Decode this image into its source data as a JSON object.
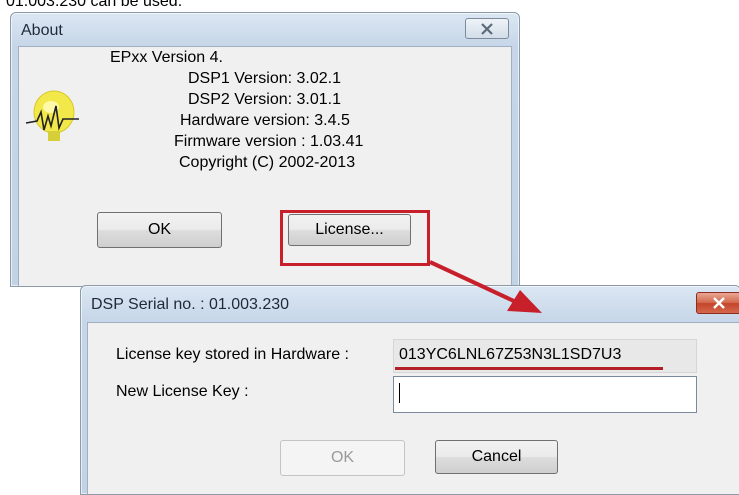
{
  "document": {
    "header_text": "01.003.230 can be used."
  },
  "about_dialog": {
    "title": "About",
    "close_icon": "close-icon",
    "logo_icon": "lightbulb-waveform-icon",
    "lines": [
      "EPxx Version 4.",
      "DSP1 Version: 3.02.1",
      "DSP2 Version: 3.01.1",
      "Hardware version: 3.4.5",
      "Firmware version : 1.03.41",
      "Copyright (C) 2002-2013"
    ],
    "ok_label": "OK",
    "license_label": "License..."
  },
  "license_dialog": {
    "title": "DSP Serial no. : 01.003.230",
    "close_icon": "close-icon",
    "stored_label": "License key stored in Hardware :",
    "stored_value": "013YC6LNL67Z53N3L1SD7U3",
    "new_label": "New License Key :",
    "new_value": "",
    "ok_label": "OK",
    "cancel_label": "Cancel"
  },
  "annotation": {
    "highlight_color": "#c8202b",
    "arrow_color": "#c8202b",
    "underline_color": "#b31e27"
  }
}
